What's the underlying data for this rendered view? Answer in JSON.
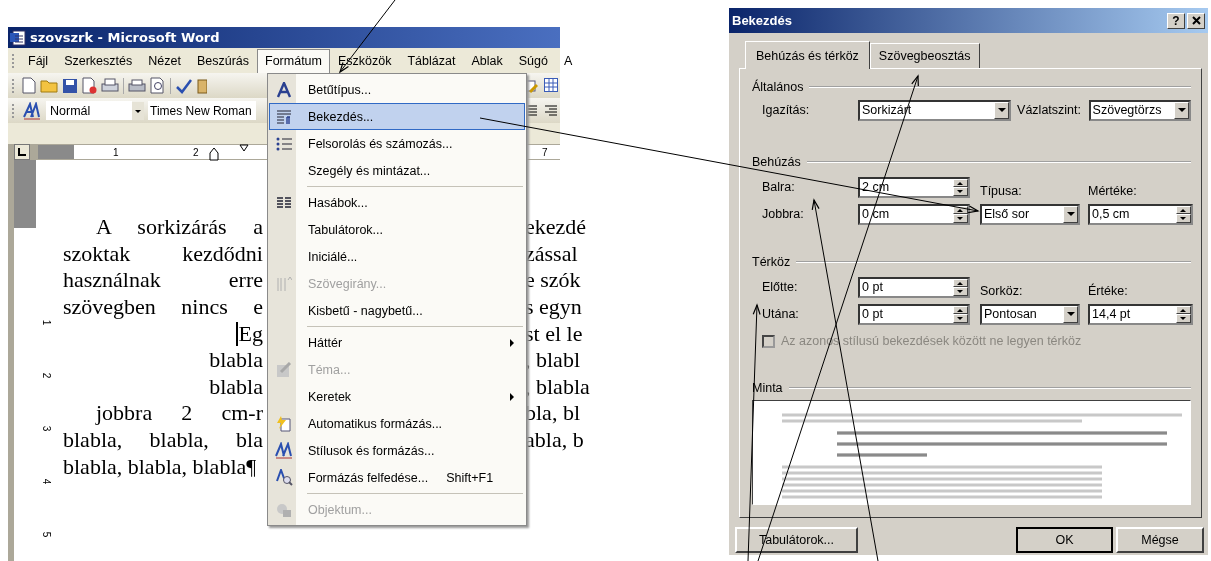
{
  "word": {
    "title": "szovszrk - Microsoft Word",
    "menu_bar": [
      {
        "label": "Fájl",
        "selected": false
      },
      {
        "label": "Szerkesztés",
        "selected": false
      },
      {
        "label": "Nézet",
        "selected": false
      },
      {
        "label": "Beszúrás",
        "selected": false
      },
      {
        "label": "Formátum",
        "selected": true
      },
      {
        "label": "Eszközök",
        "selected": false
      },
      {
        "label": "Táblázat",
        "selected": false
      },
      {
        "label": "Ablak",
        "selected": false
      },
      {
        "label": "Súgó",
        "selected": false
      },
      {
        "label": "A",
        "selected": false
      }
    ],
    "style_box": {
      "value": "Normál"
    },
    "font_box": {
      "value": "Times New Roman"
    },
    "ruler": {
      "numbers": [
        "1",
        "2"
      ],
      "right_numbers": [
        "7"
      ]
    },
    "vertical_ruler": [
      "1",
      "2",
      "3",
      "4",
      "5"
    ],
    "lines": [
      {
        "kind": "indent",
        "left": "A sorkizárás a",
        "right": "ekezdé",
        "cursor": false
      },
      {
        "kind": "justify",
        "left": "szoktak kezdődni",
        "right": "zással",
        "cursor": false
      },
      {
        "kind": "justify",
        "left": "használnak erre",
        "right": "e szók",
        "cursor": false
      },
      {
        "kind": "justify",
        "left": "szövegben nincs e",
        "right": "s egyn",
        "cursor": false
      },
      {
        "kind": "right",
        "left": "Eg",
        "right": "st el le",
        "cursor": true
      },
      {
        "kind": "right",
        "left": "blabla",
        "right": ", blabl",
        "cursor": false
      },
      {
        "kind": "right",
        "left": "blabla",
        "right": ", blabla",
        "cursor": false
      },
      {
        "kind": "indent",
        "left": "jobbra 2 cm-r",
        "right": "bla, bl",
        "cursor": false
      },
      {
        "kind": "justify",
        "left": "blabla, blabla, bla",
        "right": "abla, b",
        "cursor": false
      },
      {
        "kind": "left",
        "left": "blabla, blabla, blabla¶",
        "cursor": false
      }
    ],
    "format_menu": [
      {
        "label": "Betűtípus...",
        "selected": false,
        "disabled": false,
        "submenu": false,
        "separator_before": false
      },
      {
        "label": "Bekezdés...",
        "selected": true,
        "disabled": false,
        "submenu": false,
        "separator_before": false
      },
      {
        "label": "Felsorolás és számozás...",
        "selected": false,
        "disabled": false,
        "submenu": false,
        "separator_before": false
      },
      {
        "label": "Szegély és mintázat...",
        "selected": false,
        "disabled": false,
        "submenu": false,
        "separator_before": false
      },
      {
        "label": "Hasábok...",
        "selected": false,
        "disabled": false,
        "submenu": false,
        "separator_before": true
      },
      {
        "label": "Tabulátorok...",
        "selected": false,
        "disabled": false,
        "submenu": false,
        "separator_before": false
      },
      {
        "label": "Iniciálé...",
        "selected": false,
        "disabled": false,
        "submenu": false,
        "separator_before": false
      },
      {
        "label": "Szövegirány...",
        "selected": false,
        "disabled": true,
        "submenu": false,
        "separator_before": false
      },
      {
        "label": "Kisbetű - nagybetű...",
        "selected": false,
        "disabled": false,
        "submenu": false,
        "separator_before": false
      },
      {
        "label": "Háttér",
        "selected": false,
        "disabled": false,
        "submenu": true,
        "separator_before": true
      },
      {
        "label": "Téma...",
        "selected": false,
        "disabled": true,
        "submenu": false,
        "separator_before": false
      },
      {
        "label": "Keretek",
        "selected": false,
        "disabled": false,
        "submenu": true,
        "separator_before": false
      },
      {
        "label": "Automatikus formázás...",
        "selected": false,
        "disabled": false,
        "submenu": false,
        "separator_before": false
      },
      {
        "label": "Stílusok és formázás...",
        "selected": false,
        "disabled": false,
        "submenu": false,
        "separator_before": false
      },
      {
        "label": "Formázás felfedése...",
        "shortcut": "Shift+F1",
        "selected": false,
        "disabled": false,
        "submenu": false,
        "separator_before": false
      },
      {
        "label": "Objektum...",
        "selected": false,
        "disabled": true,
        "submenu": false,
        "separator_before": true
      }
    ]
  },
  "dialog": {
    "title": "Bekezdés",
    "help": "?",
    "tabs": [
      {
        "label": "Behúzás és térköz",
        "selected": true
      },
      {
        "label": "Szövegbeosztás",
        "selected": false
      }
    ],
    "general": {
      "heading": "Általános",
      "alignment": {
        "label": "Igazítás:",
        "value": "Sorkizárt"
      },
      "outline": {
        "label": "Vázlatszint:",
        "value": "Szövegtörzs"
      }
    },
    "indentation": {
      "heading": "Behúzás",
      "left": {
        "label": "Balra:",
        "value": "2 cm"
      },
      "right": {
        "label": "Jobbra:",
        "value": "0 cm"
      },
      "special": {
        "label": "Típusa:",
        "value": "Első sor"
      },
      "by": {
        "label": "Mértéke:",
        "value": "0,5 cm"
      }
    },
    "spacing": {
      "heading": "Térköz",
      "before": {
        "label": "Előtte:",
        "value": "0 pt"
      },
      "after": {
        "label": "Utána:",
        "value": "0 pt"
      },
      "line": {
        "label": "Sorköz:",
        "value": "Pontosan"
      },
      "at": {
        "label": "Értéke:",
        "value": "14,4 pt"
      },
      "no_space": {
        "label": "Az azonos stílusú bekezdések között ne legyen térköz",
        "checked": false,
        "disabled": true
      }
    },
    "preview": {
      "heading": "Minta"
    },
    "buttons": [
      {
        "label": "Tabulátorok..."
      },
      {
        "label": "OK"
      },
      {
        "label": "Mégse"
      }
    ]
  }
}
